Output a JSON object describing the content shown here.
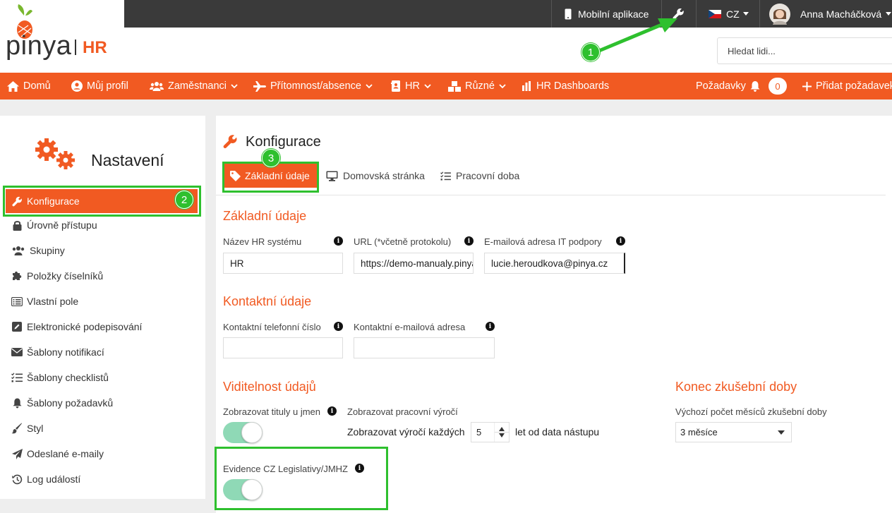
{
  "logo": {
    "brand": "pinya",
    "product": "HR"
  },
  "topbar": {
    "mobile_app": "Mobilní aplikace",
    "language": "CZ",
    "user_name": "Anna Macháčková",
    "settings_icon": "wrench-icon"
  },
  "search": {
    "placeholder": "Hledat lidi..."
  },
  "nav": {
    "home": "Domů",
    "profile": "Můj profil",
    "employees": "Zaměstnanci",
    "attendance": "Přítomnost/absence",
    "hr": "HR",
    "misc": "Různé",
    "dashboards": "HR Dashboards",
    "requests": "Požadavky",
    "requests_count": "0",
    "add_request": "Přidat požadavek"
  },
  "annotations": {
    "badge1": "1",
    "badge2": "2",
    "badge3": "3",
    "color": "#2ec02e"
  },
  "sidebar": {
    "title": "Nastavení",
    "items": [
      {
        "label": "Konfigurace",
        "icon": "wrench-icon"
      },
      {
        "label": "Úrovně přístupu",
        "icon": "lock-icon"
      },
      {
        "label": "Skupiny",
        "icon": "users-icon"
      },
      {
        "label": "Položky číselníků",
        "icon": "puzzle-icon"
      },
      {
        "label": "Vlastní pole",
        "icon": "list-icon"
      },
      {
        "label": "Elektronické podepisování",
        "icon": "pen-square-icon"
      },
      {
        "label": "Šablony notifikací",
        "icon": "envelope-icon"
      },
      {
        "label": "Šablony checklistů",
        "icon": "checklist-icon"
      },
      {
        "label": "Šablony požadavků",
        "icon": "bell-icon"
      },
      {
        "label": "Styl",
        "icon": "brush-icon"
      },
      {
        "label": "Odeslané e-maily",
        "icon": "paper-plane-icon"
      },
      {
        "label": "Log událostí",
        "icon": "history-icon"
      }
    ]
  },
  "main": {
    "title": "Konfigurace",
    "tabs": [
      "Základní údaje",
      "Domovská stránka",
      "Pracovní doba"
    ],
    "basic": {
      "title": "Základní údaje",
      "hr_name_label": "Název HR systému",
      "hr_name_value": "HR",
      "url_label": "URL (*včetně protokolu)",
      "url_value": "https://demo-manualy.pinya.cz",
      "it_email_label": "E-mailová adresa IT podpory",
      "it_email_value": "lucie.heroudkova@pinya.cz"
    },
    "contact": {
      "title": "Kontaktní údaje",
      "phone_label": "Kontaktní telefonní číslo",
      "phone_value": "",
      "email_label": "Kontaktní e-mailová adresa",
      "email_value": ""
    },
    "visibility": {
      "title": "Viditelnost údajů",
      "titles_label": "Zobrazovat tituly u jmen",
      "titles_on": true,
      "anniv_label": "Zobrazovat pracovní výročí",
      "anniv_prefix": "Zobrazovat výročí každých",
      "anniv_value": "5",
      "anniv_suffix": "let od data nástupu",
      "legislation_label": "Evidence CZ Legislativy/JMHZ",
      "legislation_on": true
    },
    "probation": {
      "title": "Konec zkušební doby",
      "label": "Výchozí počet měsíců zkušební doby",
      "value": "3 měsíce"
    }
  },
  "colors": {
    "accent": "#f15a22",
    "toggle": "#8fd9b6",
    "dark": "#3a3a3a"
  }
}
